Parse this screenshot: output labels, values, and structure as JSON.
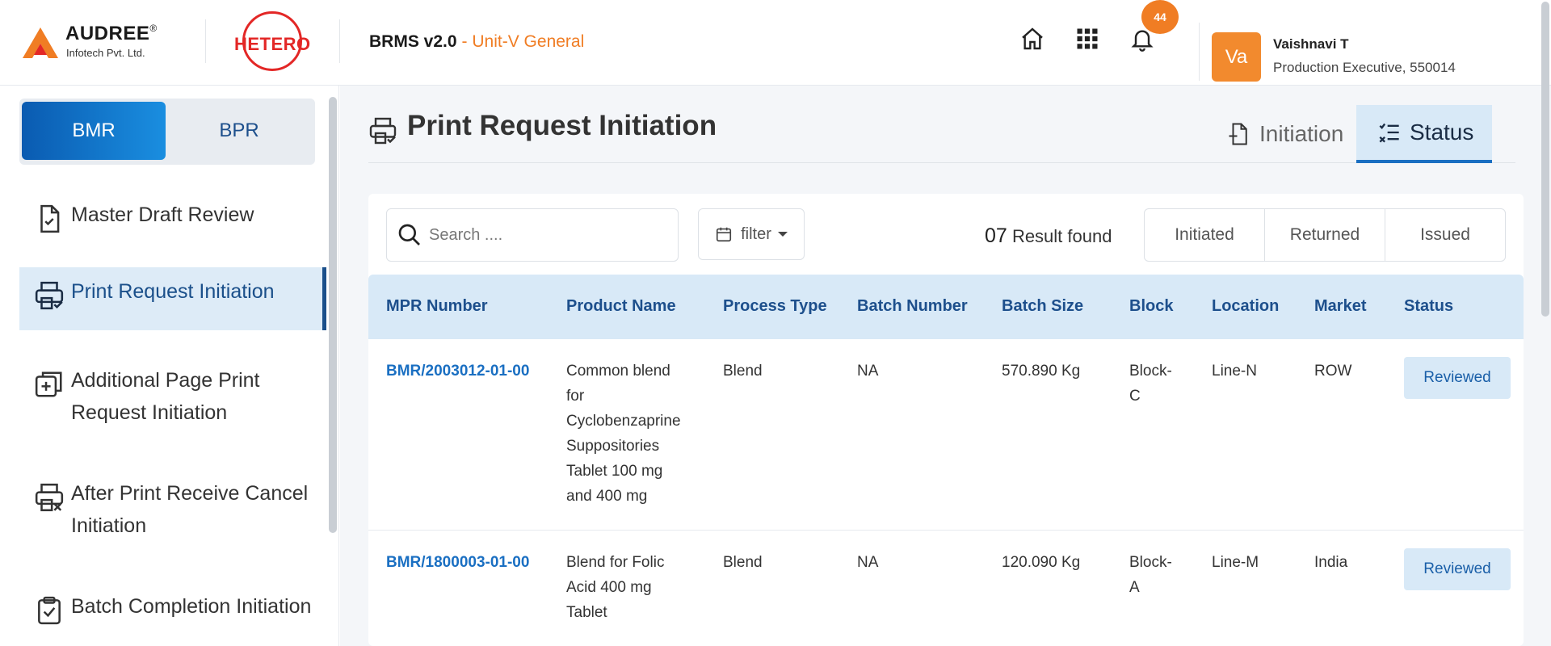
{
  "header": {
    "brand_name": "AUDREE",
    "brand_reg": "®",
    "brand_sub": "Infotech Pvt. Ltd.",
    "partner_logo": "HETERO",
    "app_name": "BRMS v2.0",
    "app_unit": "- Unit-V General",
    "notification_count": "44",
    "user": {
      "initials": "Va",
      "name": "Vaishnavi T",
      "role": "Production Executive, 550014"
    },
    "icons": [
      "home-icon",
      "apps-grid-icon",
      "bell-icon"
    ]
  },
  "sidebar": {
    "toggle": {
      "active": "BMR",
      "inactive": "BPR"
    },
    "items": [
      {
        "label": "Master Draft Review",
        "icon": "document-check-icon"
      },
      {
        "label": "Print Request Initiation",
        "icon": "printer-check-icon",
        "active": true
      },
      {
        "label": "Additional Page Print Request Initiation",
        "icon": "copy-plus-icon"
      },
      {
        "label": "After Print Receive Cancel Initiation",
        "icon": "printer-cancel-icon"
      },
      {
        "label": "Batch Completion Initiation",
        "icon": "clipboard-check-icon"
      }
    ]
  },
  "main": {
    "title": "Print Request Initiation",
    "tabs": {
      "initiation": "Initiation",
      "status": "Status"
    },
    "search_placeholder": "Search ....",
    "filter_label": "filter",
    "results_count": "07",
    "results_label": "Result found",
    "segments": [
      "Initiated",
      "Returned",
      "Issued"
    ],
    "columns": [
      "MPR Number",
      "Product Name",
      "Process Type",
      "Batch Number",
      "Batch Size",
      "Block",
      "Location",
      "Market",
      "Status"
    ],
    "rows": [
      {
        "mpr": "BMR/2003012-01-00",
        "product": "Common blend for Cyclobenzaprine Suppositories Tablet 100 mg and 400 mg",
        "process": "Blend",
        "batch": "NA",
        "size": "570.890 Kg",
        "block": "Block-C",
        "location": "Line-N",
        "market": "ROW",
        "status": "Reviewed"
      },
      {
        "mpr": "BMR/1800003-01-00",
        "product": "Blend for Folic Acid 400 mg Tablet",
        "process": "Blend",
        "batch": "NA",
        "size": "120.090 Kg",
        "block": "Block-A",
        "location": "Line-M",
        "market": "India",
        "status": "Reviewed"
      }
    ]
  },
  "colors": {
    "accent": "#f07d24",
    "primary": "#1a6fc2",
    "header_bg": "#d8e9f7"
  }
}
